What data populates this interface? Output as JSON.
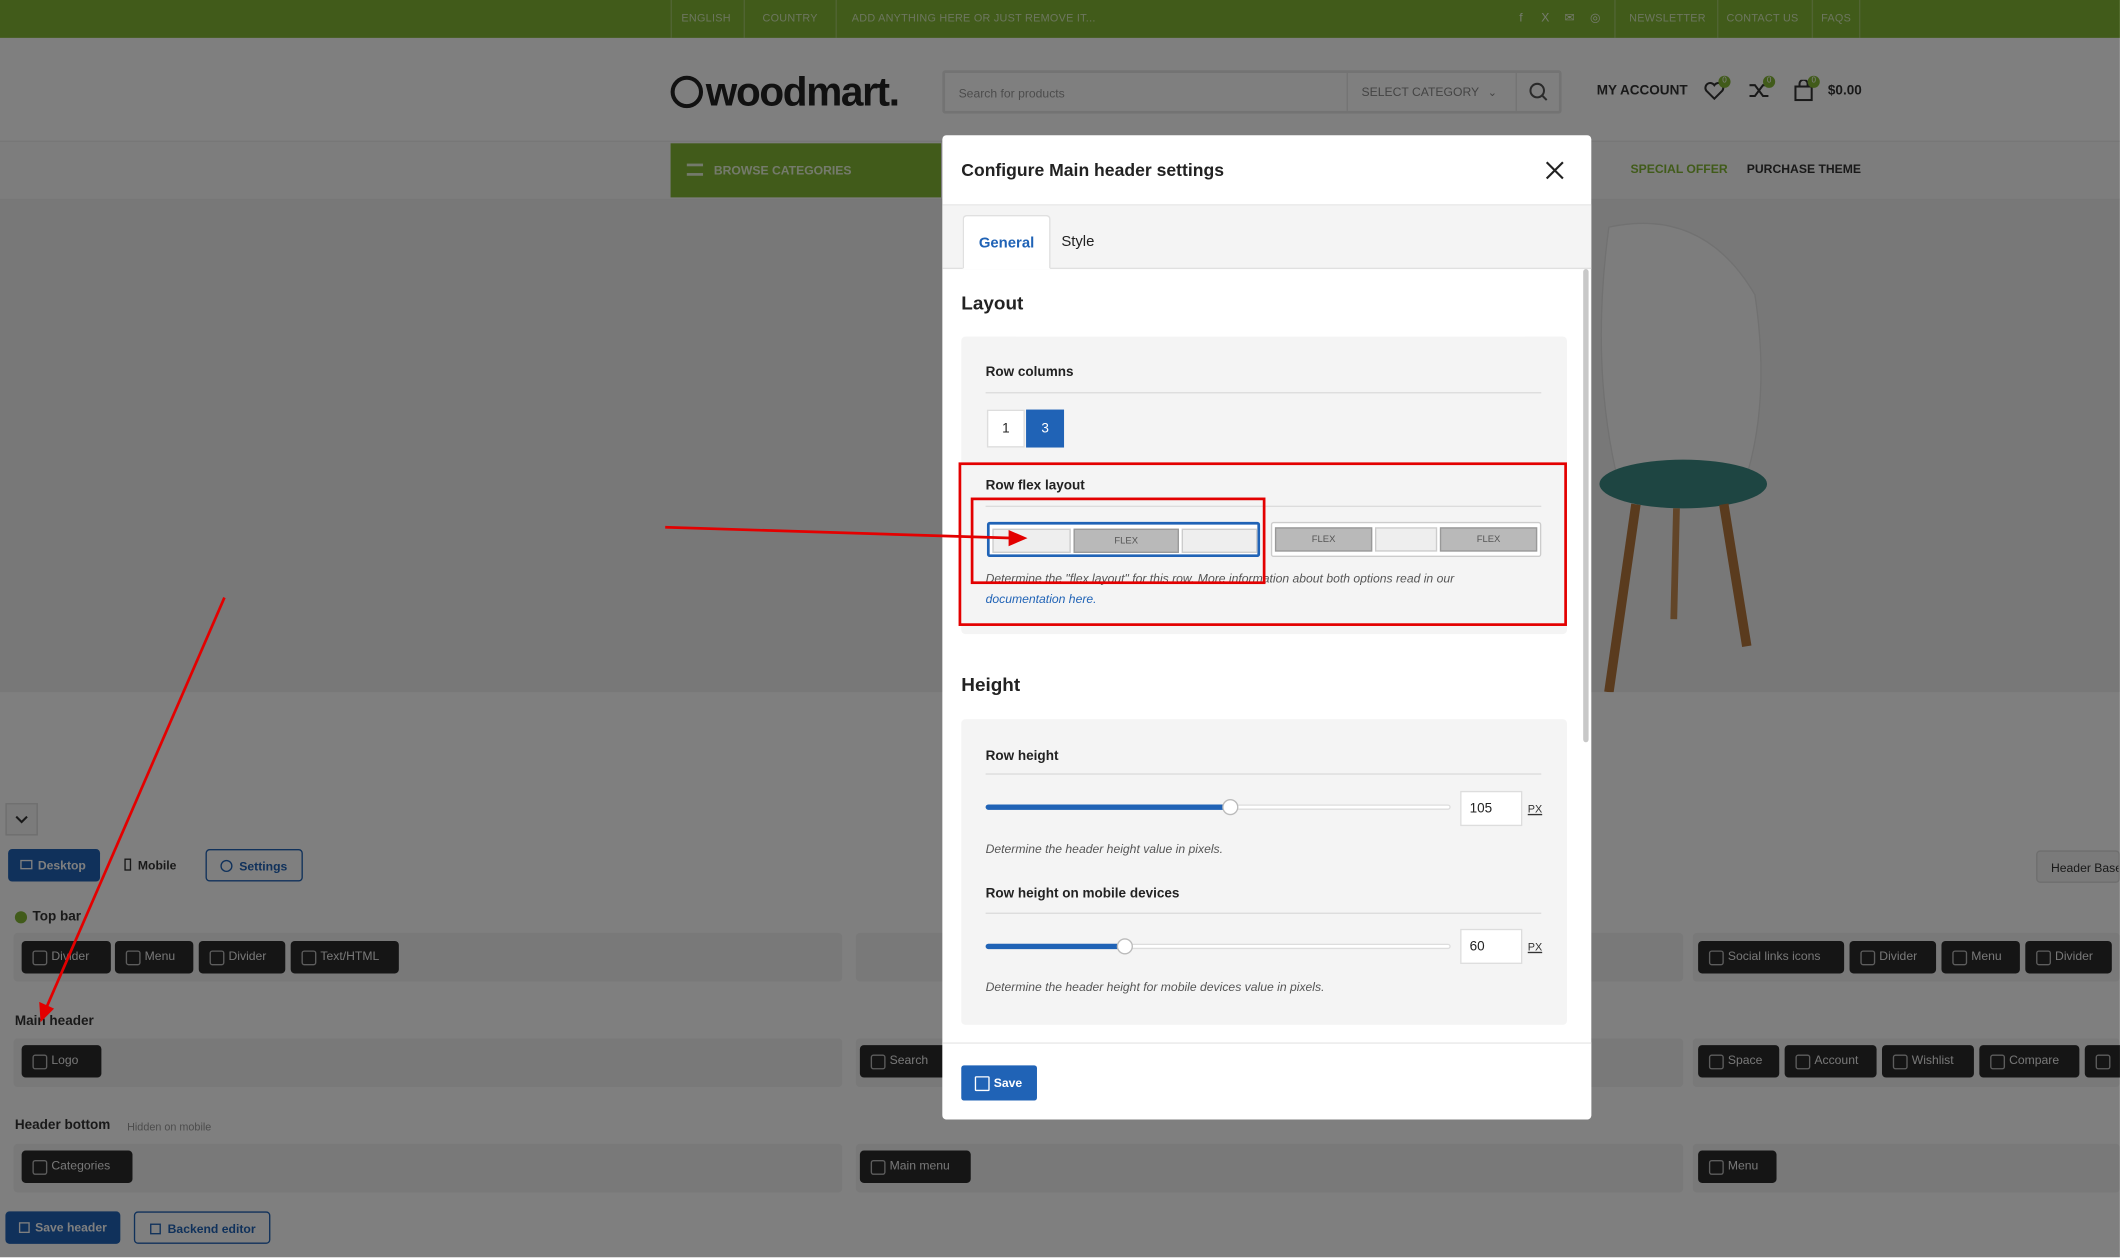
{
  "topbar": {
    "left": [
      "ENGLISH",
      "COUNTRY",
      "ADD ANYTHING HERE OR JUST REMOVE IT..."
    ],
    "right": [
      "NEWSLETTER",
      "CONTACT US",
      "FAQS"
    ],
    "social_icons": [
      "f",
      "X",
      "✉",
      "◎"
    ]
  },
  "header": {
    "logo": "woodmart.",
    "search_placeholder": "Search for products",
    "category_label": "SELECT CATEGORY",
    "account_label": "MY ACCOUNT",
    "wishlist_count": "0",
    "compare_count": "0",
    "cart_count": "0",
    "cart_total": "$0.00",
    "browse_label": "BROWSE CATEGORIES",
    "special_offer": "SPECIAL OFFER",
    "purchase_theme": "PURCHASE THEME"
  },
  "builder": {
    "tabs": {
      "desktop": "Desktop",
      "mobile": "Mobile",
      "settings": "Settings"
    },
    "right_tab": "Header Base",
    "rows": {
      "top_bar": "Top bar",
      "main_header": "Main header",
      "header_bottom": "Header bottom",
      "hidden_on_mobile": "Hidden on mobile"
    },
    "top_bar_left": [
      "Divider",
      "Menu",
      "Divider",
      "Text/HTML"
    ],
    "top_bar_right": [
      "Social links icons",
      "Divider",
      "Menu",
      "Divider"
    ],
    "main_left": [
      "Logo"
    ],
    "main_center": [
      "Search"
    ],
    "main_right": [
      "Space",
      "Account",
      "Wishlist",
      "Compare"
    ],
    "bottom_left": [
      "Categories"
    ],
    "bottom_center": [
      "Main menu"
    ],
    "bottom_right": [
      "Menu"
    ],
    "save_header": "Save header",
    "backend_editor": "Backend editor"
  },
  "modal": {
    "title": "Configure Main header settings",
    "tabs": {
      "general": "General",
      "style": "Style"
    },
    "layout": {
      "section": "Layout",
      "row_columns_label": "Row columns",
      "col_options": [
        "1",
        "3"
      ],
      "row_flex_label": "Row flex layout",
      "flex_tag": "FLEX",
      "help_text": "Determine the \"flex layout\" for this row. More information about both options read in our",
      "help_link": "documentation here."
    },
    "height": {
      "section": "Height",
      "row_height_label": "Row height",
      "row_height_value": "105",
      "row_height_unit": "PX",
      "row_height_help": "Determine the header height value in pixels.",
      "mobile_label": "Row height on mobile devices",
      "mobile_value": "60",
      "mobile_unit": "PX",
      "mobile_help": "Determine the header height for mobile devices value in pixels."
    },
    "save_label": "Save"
  },
  "colors": {
    "brand_green": "#83b735",
    "accent_blue": "#2063b6",
    "annotation_red": "#e30000"
  }
}
